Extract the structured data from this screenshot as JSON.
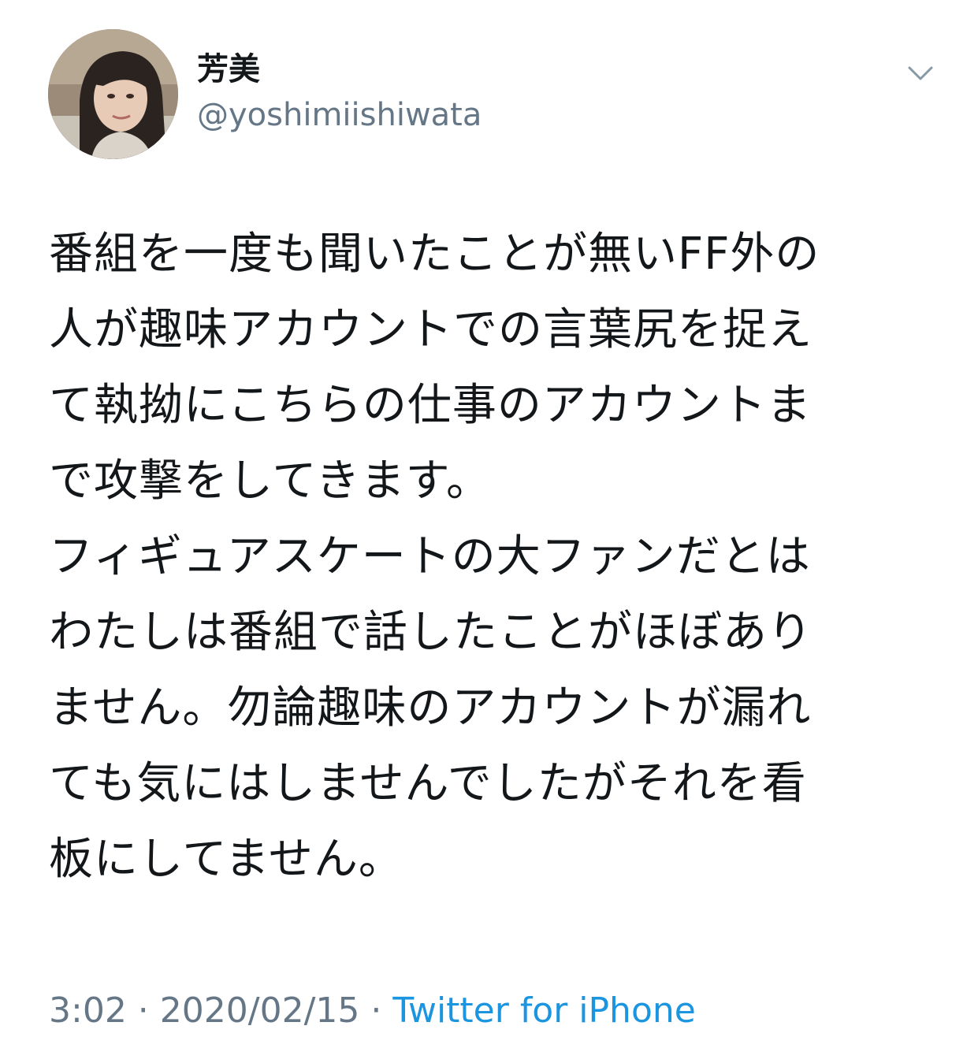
{
  "colors": {
    "text_primary": "#14171a",
    "text_secondary": "#657786",
    "link": "#1b95e0",
    "background": "#ffffff"
  },
  "author": {
    "display_name": "芳美",
    "handle": "@yoshimiishiwata",
    "avatar_icon": "user-avatar-photo"
  },
  "menu": {
    "icon": "chevron-down-icon"
  },
  "tweet": {
    "lines": [
      "番組を一度も聞いたことが無いFF外の",
      "人が趣味アカウントでの言葉尻を捉え",
      "て執拗にこちらの仕事のアカウントま",
      "で攻撃をしてきます。",
      "フィギュアスケートの大ファンだとは",
      "わたしは番組で話したことがほぼあり",
      "ません。勿論趣味のアカウントが漏れ",
      "ても気にはしませんでしたがそれを看",
      "板にしてません。"
    ]
  },
  "meta": {
    "time": "3:02",
    "separator": " · ",
    "date": "2020/02/15",
    "source": "Twitter for iPhone"
  }
}
